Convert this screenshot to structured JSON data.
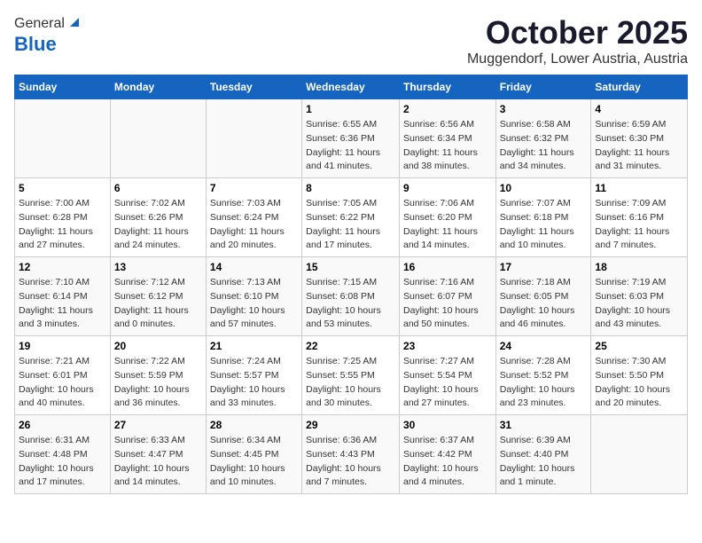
{
  "header": {
    "logo_general": "General",
    "logo_blue": "Blue",
    "title": "October 2025",
    "subtitle": "Muggendorf, Lower Austria, Austria"
  },
  "days_of_week": [
    "Sunday",
    "Monday",
    "Tuesday",
    "Wednesday",
    "Thursday",
    "Friday",
    "Saturday"
  ],
  "weeks": [
    [
      {
        "num": "",
        "info": ""
      },
      {
        "num": "",
        "info": ""
      },
      {
        "num": "",
        "info": ""
      },
      {
        "num": "1",
        "info": "Sunrise: 6:55 AM\nSunset: 6:36 PM\nDaylight: 11 hours and 41 minutes."
      },
      {
        "num": "2",
        "info": "Sunrise: 6:56 AM\nSunset: 6:34 PM\nDaylight: 11 hours and 38 minutes."
      },
      {
        "num": "3",
        "info": "Sunrise: 6:58 AM\nSunset: 6:32 PM\nDaylight: 11 hours and 34 minutes."
      },
      {
        "num": "4",
        "info": "Sunrise: 6:59 AM\nSunset: 6:30 PM\nDaylight: 11 hours and 31 minutes."
      }
    ],
    [
      {
        "num": "5",
        "info": "Sunrise: 7:00 AM\nSunset: 6:28 PM\nDaylight: 11 hours and 27 minutes."
      },
      {
        "num": "6",
        "info": "Sunrise: 7:02 AM\nSunset: 6:26 PM\nDaylight: 11 hours and 24 minutes."
      },
      {
        "num": "7",
        "info": "Sunrise: 7:03 AM\nSunset: 6:24 PM\nDaylight: 11 hours and 20 minutes."
      },
      {
        "num": "8",
        "info": "Sunrise: 7:05 AM\nSunset: 6:22 PM\nDaylight: 11 hours and 17 minutes."
      },
      {
        "num": "9",
        "info": "Sunrise: 7:06 AM\nSunset: 6:20 PM\nDaylight: 11 hours and 14 minutes."
      },
      {
        "num": "10",
        "info": "Sunrise: 7:07 AM\nSunset: 6:18 PM\nDaylight: 11 hours and 10 minutes."
      },
      {
        "num": "11",
        "info": "Sunrise: 7:09 AM\nSunset: 6:16 PM\nDaylight: 11 hours and 7 minutes."
      }
    ],
    [
      {
        "num": "12",
        "info": "Sunrise: 7:10 AM\nSunset: 6:14 PM\nDaylight: 11 hours and 3 minutes."
      },
      {
        "num": "13",
        "info": "Sunrise: 7:12 AM\nSunset: 6:12 PM\nDaylight: 11 hours and 0 minutes."
      },
      {
        "num": "14",
        "info": "Sunrise: 7:13 AM\nSunset: 6:10 PM\nDaylight: 10 hours and 57 minutes."
      },
      {
        "num": "15",
        "info": "Sunrise: 7:15 AM\nSunset: 6:08 PM\nDaylight: 10 hours and 53 minutes."
      },
      {
        "num": "16",
        "info": "Sunrise: 7:16 AM\nSunset: 6:07 PM\nDaylight: 10 hours and 50 minutes."
      },
      {
        "num": "17",
        "info": "Sunrise: 7:18 AM\nSunset: 6:05 PM\nDaylight: 10 hours and 46 minutes."
      },
      {
        "num": "18",
        "info": "Sunrise: 7:19 AM\nSunset: 6:03 PM\nDaylight: 10 hours and 43 minutes."
      }
    ],
    [
      {
        "num": "19",
        "info": "Sunrise: 7:21 AM\nSunset: 6:01 PM\nDaylight: 10 hours and 40 minutes."
      },
      {
        "num": "20",
        "info": "Sunrise: 7:22 AM\nSunset: 5:59 PM\nDaylight: 10 hours and 36 minutes."
      },
      {
        "num": "21",
        "info": "Sunrise: 7:24 AM\nSunset: 5:57 PM\nDaylight: 10 hours and 33 minutes."
      },
      {
        "num": "22",
        "info": "Sunrise: 7:25 AM\nSunset: 5:55 PM\nDaylight: 10 hours and 30 minutes."
      },
      {
        "num": "23",
        "info": "Sunrise: 7:27 AM\nSunset: 5:54 PM\nDaylight: 10 hours and 27 minutes."
      },
      {
        "num": "24",
        "info": "Sunrise: 7:28 AM\nSunset: 5:52 PM\nDaylight: 10 hours and 23 minutes."
      },
      {
        "num": "25",
        "info": "Sunrise: 7:30 AM\nSunset: 5:50 PM\nDaylight: 10 hours and 20 minutes."
      }
    ],
    [
      {
        "num": "26",
        "info": "Sunrise: 6:31 AM\nSunset: 4:48 PM\nDaylight: 10 hours and 17 minutes."
      },
      {
        "num": "27",
        "info": "Sunrise: 6:33 AM\nSunset: 4:47 PM\nDaylight: 10 hours and 14 minutes."
      },
      {
        "num": "28",
        "info": "Sunrise: 6:34 AM\nSunset: 4:45 PM\nDaylight: 10 hours and 10 minutes."
      },
      {
        "num": "29",
        "info": "Sunrise: 6:36 AM\nSunset: 4:43 PM\nDaylight: 10 hours and 7 minutes."
      },
      {
        "num": "30",
        "info": "Sunrise: 6:37 AM\nSunset: 4:42 PM\nDaylight: 10 hours and 4 minutes."
      },
      {
        "num": "31",
        "info": "Sunrise: 6:39 AM\nSunset: 4:40 PM\nDaylight: 10 hours and 1 minute."
      },
      {
        "num": "",
        "info": ""
      }
    ]
  ]
}
